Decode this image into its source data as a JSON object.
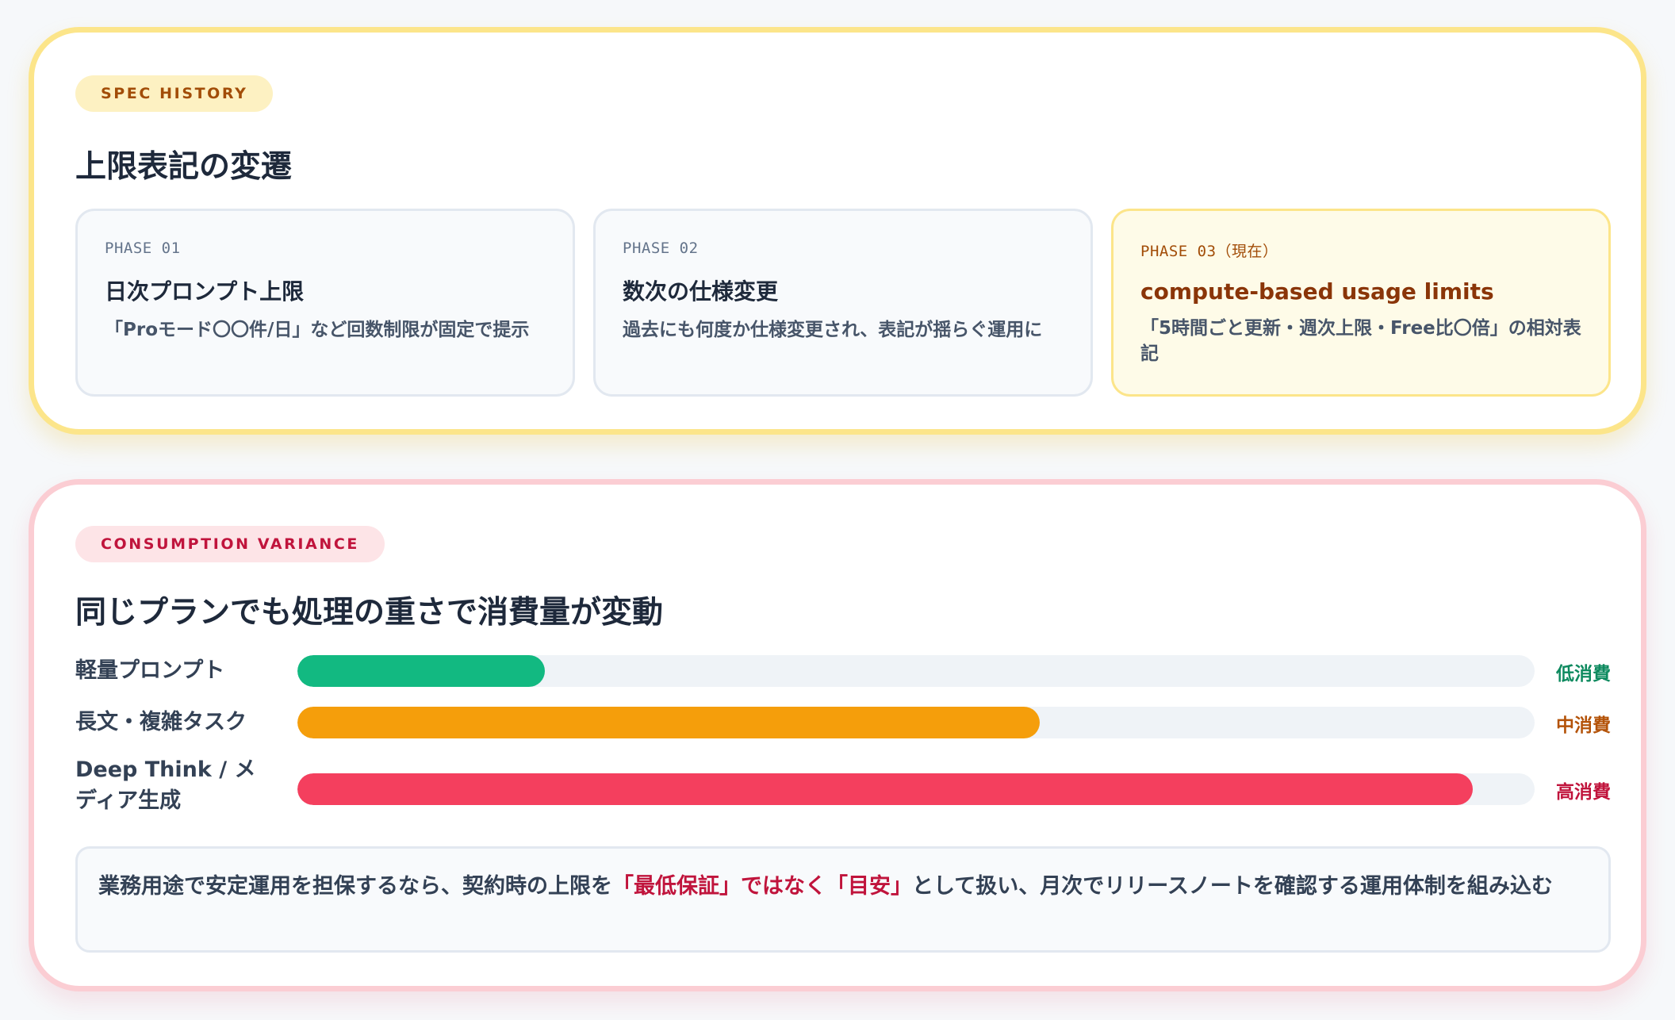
{
  "spec_history": {
    "badge": "SPEC HISTORY",
    "title": "上限表記の変遷",
    "phases": [
      {
        "label": "PHASE 01",
        "title": "日次プロンプト上限",
        "desc": "「Proモード〇〇件/日」など回数制限が固定で提示",
        "current": false
      },
      {
        "label": "PHASE 02",
        "title": "数次の仕様変更",
        "desc": "過去にも何度か仕様変更され、表記が揺らぐ運用に",
        "current": false
      },
      {
        "label": "PHASE 03（現在）",
        "title": "compute-based usage limits",
        "desc": "「5時間ごと更新・週次上限・Free比〇倍」の相対表記",
        "current": true
      }
    ]
  },
  "consumption": {
    "badge": "CONSUMPTION VARIANCE",
    "title": "同じプランでも処理の重さで消費量が変動",
    "rows": [
      {
        "label": "軽量プロンプト",
        "level": "低消費",
        "fill": 0.2,
        "color": "#12b981",
        "level_color": "#0e8a5f"
      },
      {
        "label": "長文・複雑タスク",
        "level": "中消費",
        "fill": 0.6,
        "color": "#f59e0b",
        "level_color": "#b45309"
      },
      {
        "label": "Deep Think / メディア生成",
        "level": "高消費",
        "fill": 0.95,
        "color": "#f43f5e",
        "level_color": "#c0143c"
      }
    ],
    "note": {
      "pre": "業務用途で安定運用を担保するなら、契約時の上限を",
      "emphasis": "「最低保証」ではなく「目安」",
      "post": "として扱い、月次でリリースノートを確認する運用体制を組み込む"
    }
  }
}
